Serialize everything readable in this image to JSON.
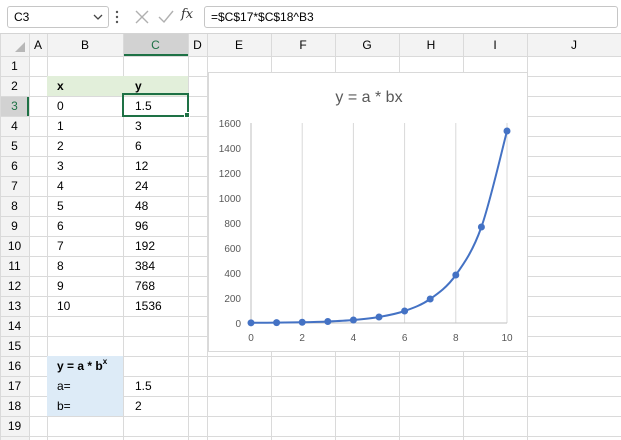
{
  "formula_bar": {
    "name_box": "C3",
    "formula": "=$C$17*$C$18^B3",
    "fx_label": "fx"
  },
  "columns": [
    "A",
    "B",
    "C",
    "D",
    "E",
    "F",
    "G",
    "H",
    "I",
    "J"
  ],
  "rows": [
    "1",
    "2",
    "3",
    "4",
    "5",
    "6",
    "7",
    "8",
    "9",
    "10",
    "11",
    "12",
    "13",
    "14",
    "15",
    "16",
    "17",
    "18",
    "19"
  ],
  "selected": {
    "column": "C",
    "row": "3"
  },
  "table": {
    "header_x": "x",
    "header_y": "y",
    "x_values": [
      "0",
      "1",
      "2",
      "3",
      "4",
      "5",
      "6",
      "7",
      "8",
      "9",
      "10"
    ],
    "y_values": [
      "1.5",
      "3",
      "6",
      "12",
      "24",
      "48",
      "96",
      "192",
      "384",
      "768",
      "1536"
    ]
  },
  "params": {
    "formula_base": "y = a * b",
    "formula_sup": "x",
    "a_label": "a=",
    "a_value": "1.5",
    "b_label": "b=",
    "b_value": "2"
  },
  "colors": {
    "header_fill": "#e2efda",
    "params_fill": "#ddebf7",
    "selection": "#1e7145",
    "series": "#4472c4"
  },
  "chart_data": {
    "type": "scatter",
    "title": "y = a * bx",
    "x": [
      0,
      1,
      2,
      3,
      4,
      5,
      6,
      7,
      8,
      9,
      10
    ],
    "y": [
      1.5,
      3,
      6,
      12,
      24,
      48,
      96,
      192,
      384,
      768,
      1536
    ],
    "xlim": [
      0,
      10
    ],
    "ylim": [
      0,
      1600
    ],
    "x_ticks": [
      0,
      2,
      4,
      6,
      8,
      10
    ],
    "y_ticks": [
      0,
      200,
      400,
      600,
      800,
      1000,
      1200,
      1400,
      1600
    ],
    "grid": "vertical",
    "smooth_line": true,
    "markers": true
  }
}
